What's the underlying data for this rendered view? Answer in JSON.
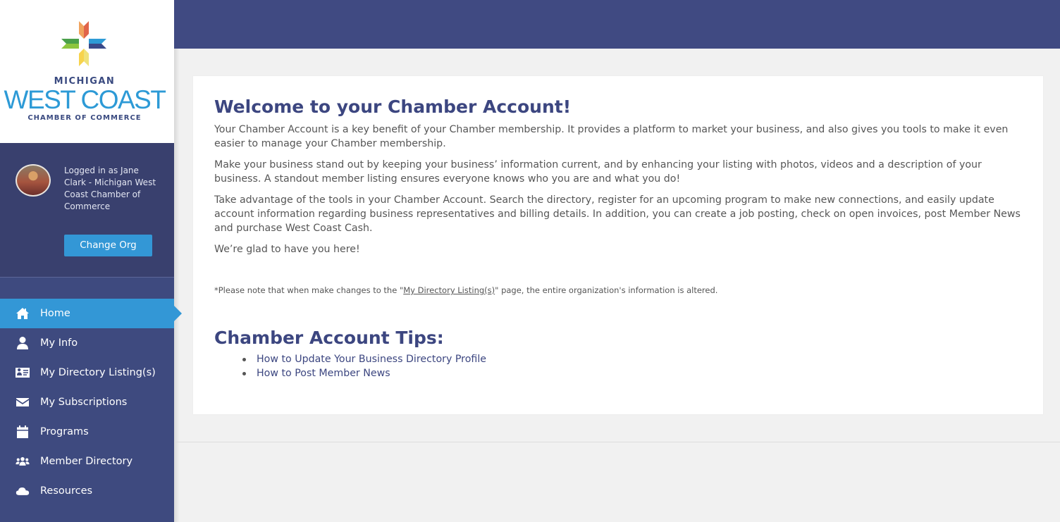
{
  "logo": {
    "line1": "MICHIGAN",
    "line2": "WEST COAST",
    "line3": "CHAMBER OF COMMERCE",
    "star_colors": [
      "#f0a35e",
      "#e0644a",
      "#2e9bd6",
      "#3a4a8a",
      "#f7d34d",
      "#efe27a",
      "#8cc53f",
      "#4aa04a"
    ]
  },
  "user": {
    "login_text": "Logged in as Jane Clark - Michigan West Coast Chamber of Commerce",
    "change_org_label": "Change Org"
  },
  "nav": {
    "items": [
      {
        "label": "Home",
        "icon": "home-icon",
        "active": true
      },
      {
        "label": "My Info",
        "icon": "user-icon",
        "active": false
      },
      {
        "label": "My Directory Listing(s)",
        "icon": "id-card-icon",
        "active": false
      },
      {
        "label": "My Subscriptions",
        "icon": "envelope-icon",
        "active": false
      },
      {
        "label": "Programs",
        "icon": "calendar-icon",
        "active": false
      },
      {
        "label": "Member Directory",
        "icon": "users-icon",
        "active": false
      },
      {
        "label": "Resources",
        "icon": "cloud-icon",
        "active": false
      }
    ]
  },
  "main": {
    "title": "Welcome to your Chamber Account!",
    "paragraphs": [
      "Your Chamber Account is a key benefit of your Chamber membership. It provides a platform to market your business, and also gives you tools to make it even easier to manage your Chamber membership.",
      "Make your business stand out by keeping your business’ information current, and by enhancing your listing with photos, videos and a description of your business. A standout member listing ensures everyone knows who you are and what you do!",
      "Take advantage of the tools in your Chamber Account. Search the directory, register for an upcoming program to make new connections, and easily update account information regarding business representatives and billing details. In addition, you can create a job posting, check on open invoices, post Member News and purchase West Coast Cash.",
      "We’re glad to have you here!"
    ],
    "note": {
      "prefix": "*Please note that when make changes to the \"",
      "link": "My Directory Listing(s)",
      "suffix": "\" page, the entire organization's information is altered."
    },
    "tips_title": "Chamber Account Tips:",
    "tips": [
      "How to Update Your Business Directory Profile",
      "How to Post Member News"
    ]
  },
  "colors": {
    "sidebar": "#3e4a7f",
    "header": "#404a82",
    "accent": "#3397d6",
    "heading": "#3c4680"
  }
}
